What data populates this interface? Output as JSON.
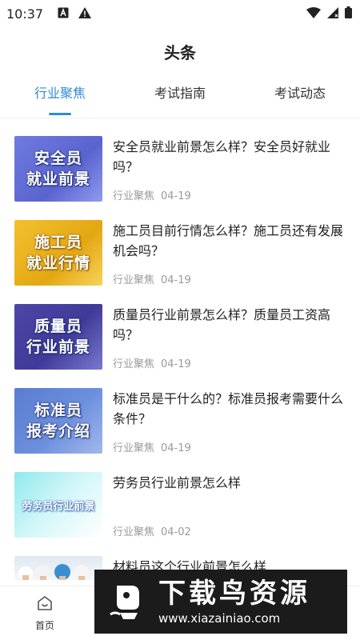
{
  "status_bar": {
    "time": "10:37",
    "icons": [
      "app-a-icon",
      "warning-icon",
      "wifi-icon",
      "signal-icon",
      "battery-icon"
    ]
  },
  "header": {
    "title": "头条"
  },
  "tabs": [
    {
      "label": "行业聚焦",
      "active": true
    },
    {
      "label": "考试指南",
      "active": false
    },
    {
      "label": "考试动态",
      "active": false
    }
  ],
  "articles": [
    {
      "thumb_line1": "安全员",
      "thumb_line2": "就业前景",
      "title": "安全员就业前景怎么样？安全员好就业吗？",
      "category": "行业聚焦",
      "date": "04-19"
    },
    {
      "thumb_line1": "施工员",
      "thumb_line2": "就业行情",
      "title": "施工员目前行情怎么样？施工员还有发展机会吗？",
      "category": "行业聚焦",
      "date": "04-19"
    },
    {
      "thumb_line1": "质量员",
      "thumb_line2": "行业前景",
      "title": "质量员行业前景怎么样？质量员工资高吗？",
      "category": "行业聚焦",
      "date": "04-19"
    },
    {
      "thumb_line1": "标准员",
      "thumb_line2": "报考介绍",
      "title": "标准员是干什么的？标准员报考需要什么条件？",
      "category": "行业聚焦",
      "date": "04-19"
    },
    {
      "thumb_text": "劳务员行业前景",
      "title": "劳务员行业前景怎么样",
      "category": "行业聚焦",
      "date": "04-02"
    },
    {
      "title": "材料员这个行业前景怎么样"
    }
  ],
  "bottom_nav": [
    {
      "label": "首页",
      "icon": "home-icon"
    }
  ],
  "watermark": {
    "title": "下载鸟资源",
    "url": "www.xiazainiao.com"
  },
  "colors": {
    "accent": "#2f8ad8",
    "meta_text": "#999999"
  }
}
